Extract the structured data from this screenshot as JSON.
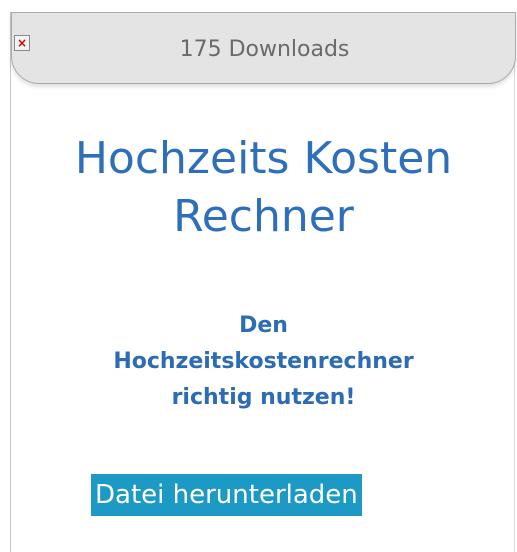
{
  "header": {
    "downloads_text": "175 Downloads",
    "broken_image_glyph": "×"
  },
  "main": {
    "title_line1": "Hochzeits Kosten",
    "title_line2": "Rechner",
    "subtitle_line1": "Den",
    "subtitle_line2": "Hochzeitskostenrechner",
    "subtitle_line3": "richtig nutzen!",
    "download_button_label": "Datei herunterladen"
  },
  "colors": {
    "title": "#2e6fbb",
    "button_bg": "#1c9ac5",
    "header_bg": "#e4e4e4"
  }
}
